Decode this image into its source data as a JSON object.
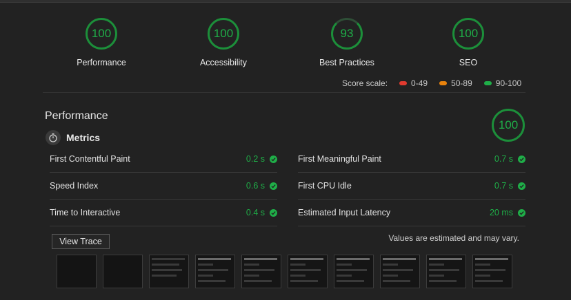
{
  "scores": [
    {
      "value": "100",
      "label": "Performance"
    },
    {
      "value": "100",
      "label": "Accessibility"
    },
    {
      "value": "93",
      "label": "Best Practices"
    },
    {
      "value": "100",
      "label": "SEO"
    }
  ],
  "scale": {
    "label": "Score scale:",
    "ranges": [
      {
        "label": "0-49",
        "color": "#e03a2f"
      },
      {
        "label": "50-89",
        "color": "#e8820c"
      },
      {
        "label": "90-100",
        "color": "#1fae48"
      }
    ]
  },
  "performance": {
    "title": "Performance",
    "score": "100",
    "metrics_title": "Metrics",
    "metrics": [
      {
        "name": "First Contentful Paint",
        "value": "0.2 s"
      },
      {
        "name": "First Meaningful Paint",
        "value": "0.7 s"
      },
      {
        "name": "Speed Index",
        "value": "0.6 s"
      },
      {
        "name": "First CPU Idle",
        "value": "0.7 s"
      },
      {
        "name": "Time to Interactive",
        "value": "0.4 s"
      },
      {
        "name": "Estimated Input Latency",
        "value": "20 ms"
      }
    ],
    "view_trace": "View Trace",
    "note": "Values are estimated and may vary."
  },
  "colors": {
    "pass": "#1fae48",
    "background": "#222222"
  }
}
